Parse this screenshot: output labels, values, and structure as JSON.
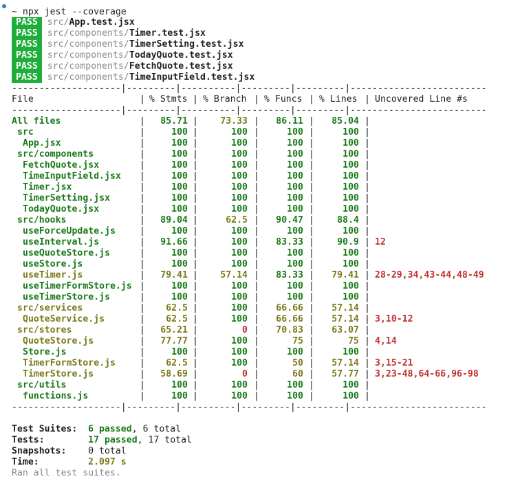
{
  "prompt": {
    "symbol": "~",
    "command": "npx jest --coverage"
  },
  "test_results": [
    {
      "status": "PASS",
      "dir": "src/",
      "file": "App.test.jsx"
    },
    {
      "status": "PASS",
      "dir": "src/components/",
      "file": "Timer.test.jsx"
    },
    {
      "status": "PASS",
      "dir": "src/components/",
      "file": "TimerSetting.test.jsx"
    },
    {
      "status": "PASS",
      "dir": "src/components/",
      "file": "TodayQuote.test.jsx"
    },
    {
      "status": "PASS",
      "dir": "src/components/",
      "file": "FetchQuote.test.jsx"
    },
    {
      "status": "PASS",
      "dir": "src/components/",
      "file": "TimeInputField.test.jsx"
    }
  ],
  "coverage_table": {
    "divider": "--------------------|---------|----------|---------|---------|-------------------------",
    "headers": [
      "File",
      "% Stmts",
      "% Branch",
      "% Funcs",
      "% Lines",
      "Uncovered Line #s"
    ],
    "rows": [
      {
        "file": "All files",
        "indent": 0,
        "stmts": "85.71",
        "branch": "73.33",
        "funcs": "86.11",
        "lines": "85.04",
        "uncovered": "",
        "c": [
          "green",
          "olive",
          "green",
          "green"
        ]
      },
      {
        "file": "src",
        "indent": 1,
        "stmts": "100",
        "branch": "100",
        "funcs": "100",
        "lines": "100",
        "uncovered": "",
        "c": [
          "green",
          "green",
          "green",
          "green"
        ]
      },
      {
        "file": "App.jsx",
        "indent": 2,
        "stmts": "100",
        "branch": "100",
        "funcs": "100",
        "lines": "100",
        "uncovered": "",
        "c": [
          "green",
          "green",
          "green",
          "green"
        ]
      },
      {
        "file": "src/components",
        "indent": 1,
        "stmts": "100",
        "branch": "100",
        "funcs": "100",
        "lines": "100",
        "uncovered": "",
        "c": [
          "green",
          "green",
          "green",
          "green"
        ]
      },
      {
        "file": "FetchQuote.jsx",
        "indent": 2,
        "stmts": "100",
        "branch": "100",
        "funcs": "100",
        "lines": "100",
        "uncovered": "",
        "c": [
          "green",
          "green",
          "green",
          "green"
        ]
      },
      {
        "file": "TimeInputField.jsx",
        "indent": 2,
        "stmts": "100",
        "branch": "100",
        "funcs": "100",
        "lines": "100",
        "uncovered": "",
        "c": [
          "green",
          "green",
          "green",
          "green"
        ]
      },
      {
        "file": "Timer.jsx",
        "indent": 2,
        "stmts": "100",
        "branch": "100",
        "funcs": "100",
        "lines": "100",
        "uncovered": "",
        "c": [
          "green",
          "green",
          "green",
          "green"
        ]
      },
      {
        "file": "TimerSetting.jsx",
        "indent": 2,
        "stmts": "100",
        "branch": "100",
        "funcs": "100",
        "lines": "100",
        "uncovered": "",
        "c": [
          "green",
          "green",
          "green",
          "green"
        ]
      },
      {
        "file": "TodayQuote.jsx",
        "indent": 2,
        "stmts": "100",
        "branch": "100",
        "funcs": "100",
        "lines": "100",
        "uncovered": "",
        "c": [
          "green",
          "green",
          "green",
          "green"
        ]
      },
      {
        "file": "src/hooks",
        "indent": 1,
        "stmts": "89.04",
        "branch": "62.5",
        "funcs": "90.47",
        "lines": "88.4",
        "uncovered": "",
        "c": [
          "green",
          "olive",
          "green",
          "green"
        ]
      },
      {
        "file": "useForceUpdate.js",
        "indent": 2,
        "stmts": "100",
        "branch": "100",
        "funcs": "100",
        "lines": "100",
        "uncovered": "",
        "c": [
          "green",
          "green",
          "green",
          "green"
        ]
      },
      {
        "file": "useInterval.js",
        "indent": 2,
        "stmts": "91.66",
        "branch": "100",
        "funcs": "83.33",
        "lines": "90.9",
        "uncovered": "12",
        "c": [
          "green",
          "green",
          "green",
          "green"
        ]
      },
      {
        "file": "useQuoteStore.js",
        "indent": 2,
        "stmts": "100",
        "branch": "100",
        "funcs": "100",
        "lines": "100",
        "uncovered": "",
        "c": [
          "green",
          "green",
          "green",
          "green"
        ]
      },
      {
        "file": "useStore.js",
        "indent": 2,
        "stmts": "100",
        "branch": "100",
        "funcs": "100",
        "lines": "100",
        "uncovered": "",
        "c": [
          "green",
          "green",
          "green",
          "green"
        ]
      },
      {
        "file": "useTimer.js",
        "indent": 2,
        "stmts": "79.41",
        "branch": "57.14",
        "funcs": "83.33",
        "lines": "79.41",
        "uncovered": "28-29,34,43-44,48-49",
        "c": [
          "olive",
          "olive",
          "green",
          "olive"
        ]
      },
      {
        "file": "useTimerFormStore.js",
        "indent": 2,
        "stmts": "100",
        "branch": "100",
        "funcs": "100",
        "lines": "100",
        "uncovered": "",
        "c": [
          "green",
          "green",
          "green",
          "green"
        ]
      },
      {
        "file": "useTimerStore.js",
        "indent": 2,
        "stmts": "100",
        "branch": "100",
        "funcs": "100",
        "lines": "100",
        "uncovered": "",
        "c": [
          "green",
          "green",
          "green",
          "green"
        ]
      },
      {
        "file": "src/services",
        "indent": 1,
        "stmts": "62.5",
        "branch": "100",
        "funcs": "66.66",
        "lines": "57.14",
        "uncovered": "",
        "c": [
          "olive",
          "green",
          "olive",
          "olive"
        ]
      },
      {
        "file": "QuoteService.js",
        "indent": 2,
        "stmts": "62.5",
        "branch": "100",
        "funcs": "66.66",
        "lines": "57.14",
        "uncovered": "3,10-12",
        "c": [
          "olive",
          "green",
          "olive",
          "olive"
        ]
      },
      {
        "file": "src/stores",
        "indent": 1,
        "stmts": "65.21",
        "branch": "0",
        "funcs": "70.83",
        "lines": "63.07",
        "uncovered": "",
        "c": [
          "olive",
          "red",
          "olive",
          "olive"
        ]
      },
      {
        "file": "QuoteStore.js",
        "indent": 2,
        "stmts": "77.77",
        "branch": "100",
        "funcs": "75",
        "lines": "75",
        "uncovered": "4,14",
        "c": [
          "olive",
          "green",
          "olive",
          "olive"
        ]
      },
      {
        "file": "Store.js",
        "indent": 2,
        "stmts": "100",
        "branch": "100",
        "funcs": "100",
        "lines": "100",
        "uncovered": "",
        "c": [
          "green",
          "green",
          "green",
          "green"
        ]
      },
      {
        "file": "TimerFormStore.js",
        "indent": 2,
        "stmts": "62.5",
        "branch": "100",
        "funcs": "50",
        "lines": "57.14",
        "uncovered": "3,15-21",
        "c": [
          "olive",
          "green",
          "olive",
          "olive"
        ]
      },
      {
        "file": "TimerStore.js",
        "indent": 2,
        "stmts": "58.69",
        "branch": "0",
        "funcs": "60",
        "lines": "57.77",
        "uncovered": "3,23-48,64-66,96-98",
        "c": [
          "olive",
          "red",
          "olive",
          "olive"
        ]
      },
      {
        "file": "src/utils",
        "indent": 1,
        "stmts": "100",
        "branch": "100",
        "funcs": "100",
        "lines": "100",
        "uncovered": "",
        "c": [
          "green",
          "green",
          "green",
          "green"
        ]
      },
      {
        "file": "functions.js",
        "indent": 2,
        "stmts": "100",
        "branch": "100",
        "funcs": "100",
        "lines": "100",
        "uncovered": "",
        "c": [
          "green",
          "green",
          "green",
          "green"
        ]
      }
    ]
  },
  "summary": {
    "suites_label": "Test Suites:",
    "suites_passed": "6 passed",
    "suites_rest": ", 6 total",
    "tests_label": "Tests:",
    "tests_passed": "17 passed",
    "tests_rest": ", 17 total",
    "snapshots_label": "Snapshots:",
    "snapshots_value": "0 total",
    "time_label": "Time:",
    "time_value": "2.097 s",
    "footer": "Ran all test suites."
  },
  "colors": {
    "pass_bg": "#1fae3b",
    "good": "#197a19",
    "medium": "#7a7a1a",
    "bad": "#c43030",
    "muted": "#8a8a8a"
  }
}
